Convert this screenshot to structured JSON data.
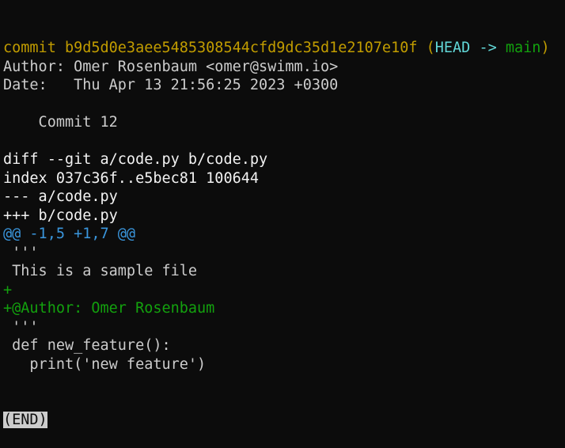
{
  "terminal": {
    "lines": [
      {
        "segments": [
          {
            "text": "commit b9d5d0e3aee5485308544cfd9dc35d1e2107e10f ",
            "color": "yellow"
          },
          {
            "text": "(",
            "color": "yellow"
          },
          {
            "text": "HEAD -> ",
            "color": "cyan-bright"
          },
          {
            "text": "main",
            "color": "green"
          },
          {
            "text": ")",
            "color": "yellow"
          }
        ]
      },
      {
        "segments": [
          {
            "text": "Author: Omer Rosenbaum <omer@swimm.io>",
            "color": "gray"
          }
        ]
      },
      {
        "segments": [
          {
            "text": "Date:   Thu Apr 13 21:56:25 2023 +0300",
            "color": "gray"
          }
        ]
      },
      {
        "segments": [
          {
            "text": "",
            "color": "gray"
          }
        ]
      },
      {
        "segments": [
          {
            "text": "    Commit 12",
            "color": "gray"
          }
        ]
      },
      {
        "segments": [
          {
            "text": "",
            "color": "gray"
          }
        ]
      },
      {
        "segments": [
          {
            "text": "diff --git a/code.py b/code.py",
            "color": "white"
          }
        ]
      },
      {
        "segments": [
          {
            "text": "index 037c36f..e5bec81 100644",
            "color": "white"
          }
        ]
      },
      {
        "segments": [
          {
            "text": "--- a/code.py",
            "color": "white"
          }
        ]
      },
      {
        "segments": [
          {
            "text": "+++ b/code.py",
            "color": "white"
          }
        ]
      },
      {
        "segments": [
          {
            "text": "@@ -1,5 +1,7 @@",
            "color": "cyan"
          }
        ]
      },
      {
        "segments": [
          {
            "text": " '''",
            "color": "gray"
          }
        ]
      },
      {
        "segments": [
          {
            "text": " This is a sample file",
            "color": "gray"
          }
        ]
      },
      {
        "segments": [
          {
            "text": "+",
            "color": "green"
          }
        ]
      },
      {
        "segments": [
          {
            "text": "+@Author: Omer Rosenbaum",
            "color": "green"
          }
        ]
      },
      {
        "segments": [
          {
            "text": " '''",
            "color": "gray"
          }
        ]
      },
      {
        "segments": [
          {
            "text": " def new_feature():",
            "color": "gray"
          }
        ]
      },
      {
        "segments": [
          {
            "text": "   print('new feature')",
            "color": "gray"
          }
        ]
      }
    ],
    "end_marker": "(END)"
  },
  "colors": {
    "background": "#0c0c0c",
    "default_text": "#cccccc",
    "commit_yellow": "#c19c00",
    "head_cyan": "#61d6d6",
    "branch_green": "#13a10e",
    "hunk_blue": "#3a96dd",
    "added_green": "#13a10e"
  }
}
